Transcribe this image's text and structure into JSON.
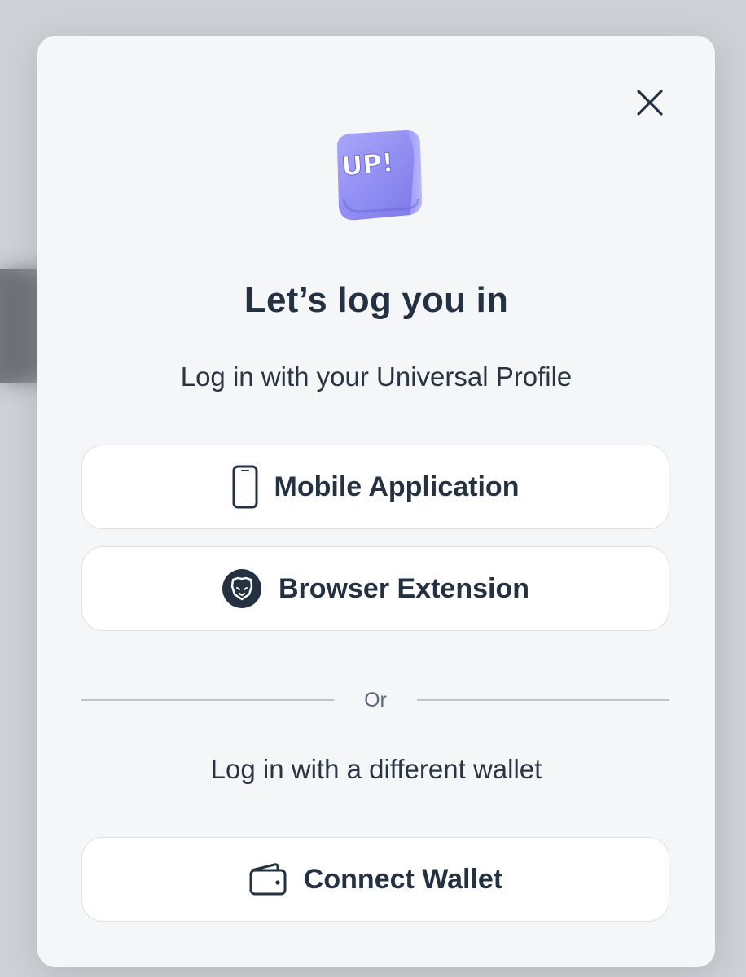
{
  "modal": {
    "title": "Let’s log you in",
    "subtitle": "Log in with your Universal Profile",
    "logo_text": "UP!",
    "close_icon": "close-icon",
    "buttons": [
      {
        "label": "Mobile Application",
        "icon": "smartphone-icon"
      },
      {
        "label": "Browser Extension",
        "icon": "lion-badge-icon"
      }
    ],
    "divider_text": "Or",
    "alt_subtitle": "Log in with a different wallet",
    "wallet_button": {
      "label": "Connect Wallet",
      "icon": "wallet-icon"
    }
  },
  "colors": {
    "modal_bg": "#f5f6f8",
    "text_primary": "#243142",
    "logo_purple": "#8f8cf3",
    "divider": "#b7c6d2"
  }
}
